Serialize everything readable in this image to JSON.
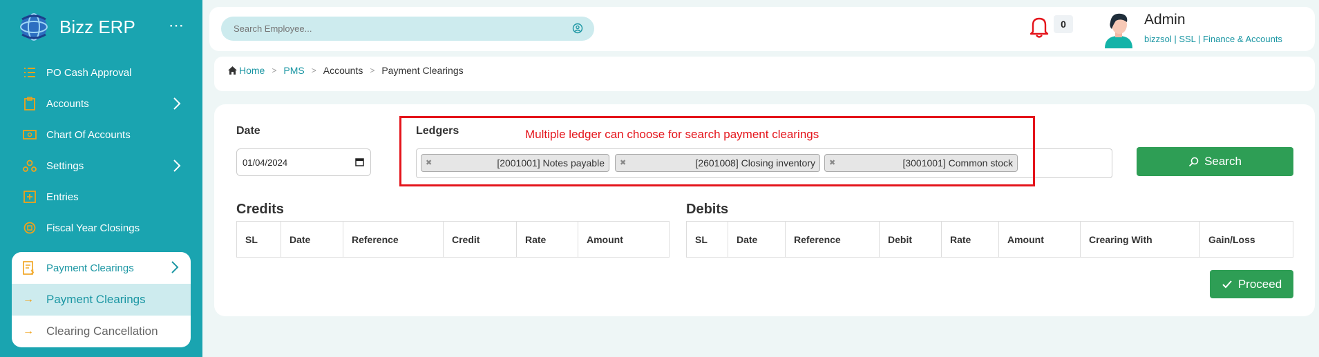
{
  "app": {
    "brand": "Bizz ERP",
    "menu_dots": "⋯"
  },
  "sidebar": {
    "items": [
      {
        "label": "PO Cash Approval",
        "icon": "list-icon",
        "has_chevron": false
      },
      {
        "label": "Accounts",
        "icon": "clipboard-icon",
        "has_chevron": true
      },
      {
        "label": "Chart Of Accounts",
        "icon": "money-icon",
        "has_chevron": false
      },
      {
        "label": "Settings",
        "icon": "nodes-icon",
        "has_chevron": true
      },
      {
        "label": "Entries",
        "icon": "plus-square-icon",
        "has_chevron": false
      },
      {
        "label": "Fiscal Year Closings",
        "icon": "circle-square-icon",
        "has_chevron": false
      }
    ],
    "open_group": {
      "label": "Payment Clearings",
      "icon": "invoice-icon",
      "children": [
        {
          "label": "Payment Clearings",
          "active": true
        },
        {
          "label": "Clearing Cancellation",
          "active": false
        }
      ]
    }
  },
  "topbar": {
    "search_placeholder": "Search Employee...",
    "notification_count": "0",
    "user_name": "Admin",
    "user_sub": "bizzsol | SSL  | Finance & Accounts"
  },
  "breadcrumb": {
    "home": "Home",
    "items": [
      "PMS",
      "Accounts",
      "Payment Clearings"
    ]
  },
  "form": {
    "date_label": "Date",
    "date_value": "01/04/2024",
    "ledgers_label": "Ledgers",
    "selected_ledgers": [
      "[2001001] Notes payable",
      "[2601008] Closing inventory",
      "[3001001] Common stock"
    ],
    "search_button": "Search"
  },
  "annotation": {
    "text": "Multiple ledger can choose for search payment clearings",
    "color": "#e4141b"
  },
  "credits": {
    "title": "Credits",
    "columns": [
      "SL",
      "Date",
      "Reference",
      "Credit",
      "Rate",
      "Amount"
    ]
  },
  "debits": {
    "title": "Debits",
    "columns": [
      "SL",
      "Date",
      "Reference",
      "Debit",
      "Rate",
      "Amount",
      "Crearing With",
      "Gain/Loss"
    ]
  },
  "proceed_button": "Proceed",
  "colors": {
    "sidebar": "#1aa4b0",
    "accent": "#1a96a3",
    "button": "#2e9e55",
    "icon_orange": "#f0a21a"
  }
}
